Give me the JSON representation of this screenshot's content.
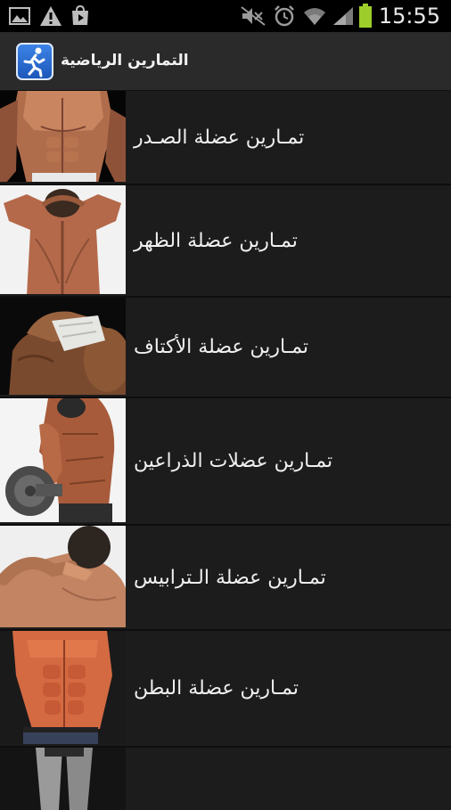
{
  "status_bar": {
    "time": "15:55",
    "icons": [
      "gallery-icon",
      "warning-icon",
      "play-store-icon",
      "mute-icon",
      "alarm-icon",
      "wifi-icon",
      "signal-icon",
      "battery-icon"
    ]
  },
  "action_bar": {
    "title": "التمارين الرياضية",
    "app_icon": "runner-icon"
  },
  "list": {
    "items": [
      {
        "label": "تمـارين عضلة الصـدر",
        "thumb": "chest-photo"
      },
      {
        "label": "تمـارين عضلة الظهر",
        "thumb": "back-photo"
      },
      {
        "label": "تمـارين عضلة الأكتاف",
        "thumb": "shoulders-photo"
      },
      {
        "label": "تمـارين عضلات الذراعين",
        "thumb": "arms-photo"
      },
      {
        "label": "تمـارين عضلة الـترابيس",
        "thumb": "trapezius-photo"
      },
      {
        "label": "تمـارين عضلة البطن",
        "thumb": "abs-photo"
      },
      {
        "label": "",
        "thumb": "legs-photo"
      }
    ]
  },
  "colors": {
    "background": "#1c1c1c",
    "action_bar": "#2a2a2a",
    "battery": "#9ccd2a",
    "app_icon": "#2f6fd6"
  }
}
